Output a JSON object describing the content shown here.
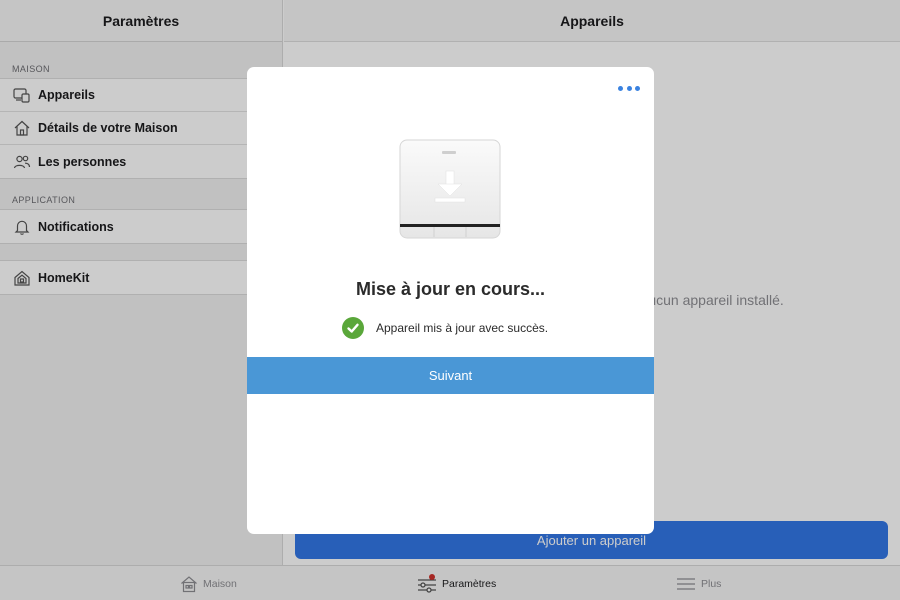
{
  "sidebar": {
    "title": "Paramètres",
    "sections": [
      {
        "title": "MAISON",
        "items": [
          {
            "label": "Appareils",
            "icon": "devices-icon"
          },
          {
            "label": "Détails de votre Maison",
            "icon": "house-icon"
          },
          {
            "label": "Les personnes",
            "icon": "people-icon"
          }
        ]
      },
      {
        "title": "APPLICATION",
        "items": [
          {
            "label": "Notifications",
            "icon": "bell-icon"
          }
        ]
      }
    ],
    "homekit": {
      "label": "HomeKit",
      "icon": "homekit-icon"
    }
  },
  "main": {
    "title": "Appareils",
    "empty_text": "Aucun appareil installé.",
    "add_button": "Ajouter un appareil"
  },
  "tabbar": {
    "tabs": [
      {
        "label": "Maison",
        "icon": "house-icon",
        "active": false
      },
      {
        "label": "Paramètres",
        "icon": "sliders-icon",
        "active": true
      },
      {
        "label": "Plus",
        "icon": "menu-icon",
        "active": false
      }
    ]
  },
  "modal": {
    "title": "Mise à jour en cours...",
    "status": "Appareil mis à jour avec succès.",
    "next_button": "Suivant",
    "device_icon": "thermostat-download-icon",
    "more_icon": "more-icon"
  },
  "colors": {
    "accent": "#3377e6",
    "modal_button": "#4a97d6",
    "success": "#5aa73a",
    "badge": "#d0312d"
  }
}
